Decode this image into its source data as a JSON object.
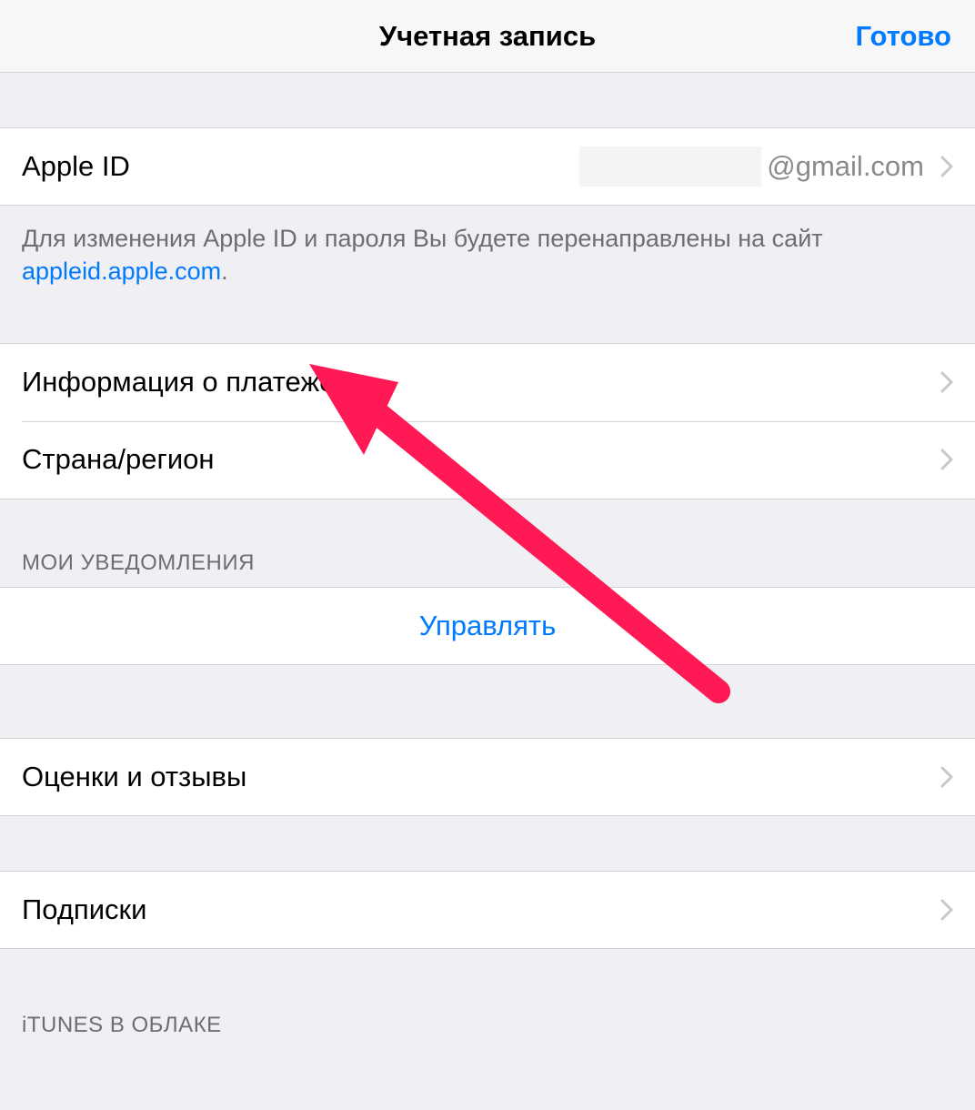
{
  "navbar": {
    "title": "Учетная запись",
    "done": "Готово"
  },
  "apple_id": {
    "label": "Apple ID",
    "value_suffix": "@gmail.com"
  },
  "apple_id_note": {
    "text_before": "Для изменения Apple ID и пароля Вы будете перенаправлены на сайт ",
    "link": "appleid.apple.com",
    "text_after": "."
  },
  "rows": {
    "payment_info": "Информация о платеже",
    "country_region": "Страна/регион",
    "ratings_reviews": "Оценки и отзывы",
    "subscriptions": "Подписки"
  },
  "sections": {
    "my_notifications": "МОИ УВЕДОМЛЕНИЯ",
    "itunes_cloud": "iTUNES В ОБЛАКЕ"
  },
  "actions": {
    "manage": "Управлять"
  },
  "annotation": {
    "arrow_color": "#ff1a55"
  }
}
